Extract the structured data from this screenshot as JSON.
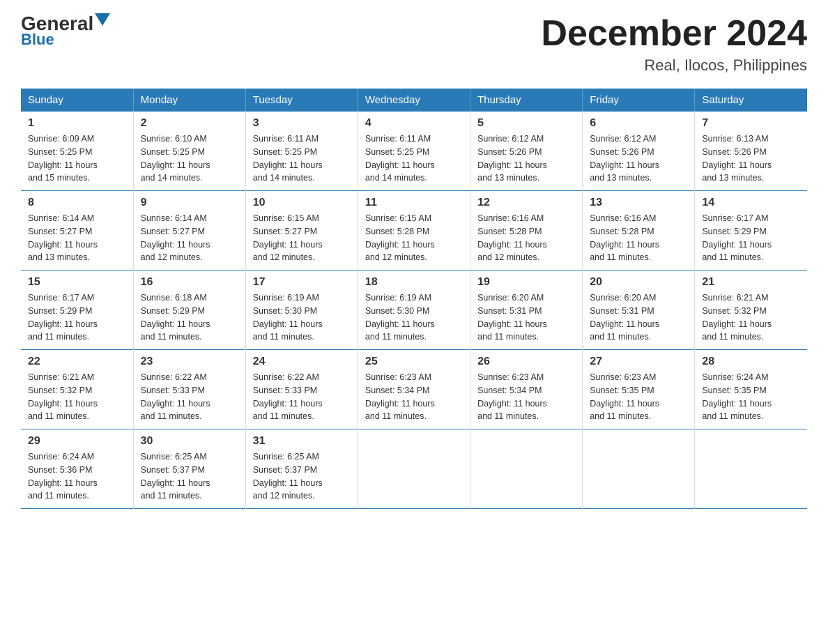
{
  "header": {
    "logo_general": "General",
    "logo_blue": "Blue",
    "title": "December 2024",
    "subtitle": "Real, Ilocos, Philippines"
  },
  "days_of_week": [
    "Sunday",
    "Monday",
    "Tuesday",
    "Wednesday",
    "Thursday",
    "Friday",
    "Saturday"
  ],
  "weeks": [
    [
      {
        "day": "1",
        "info": "Sunrise: 6:09 AM\nSunset: 5:25 PM\nDaylight: 11 hours\nand 15 minutes."
      },
      {
        "day": "2",
        "info": "Sunrise: 6:10 AM\nSunset: 5:25 PM\nDaylight: 11 hours\nand 14 minutes."
      },
      {
        "day": "3",
        "info": "Sunrise: 6:11 AM\nSunset: 5:25 PM\nDaylight: 11 hours\nand 14 minutes."
      },
      {
        "day": "4",
        "info": "Sunrise: 6:11 AM\nSunset: 5:25 PM\nDaylight: 11 hours\nand 14 minutes."
      },
      {
        "day": "5",
        "info": "Sunrise: 6:12 AM\nSunset: 5:26 PM\nDaylight: 11 hours\nand 13 minutes."
      },
      {
        "day": "6",
        "info": "Sunrise: 6:12 AM\nSunset: 5:26 PM\nDaylight: 11 hours\nand 13 minutes."
      },
      {
        "day": "7",
        "info": "Sunrise: 6:13 AM\nSunset: 5:26 PM\nDaylight: 11 hours\nand 13 minutes."
      }
    ],
    [
      {
        "day": "8",
        "info": "Sunrise: 6:14 AM\nSunset: 5:27 PM\nDaylight: 11 hours\nand 13 minutes."
      },
      {
        "day": "9",
        "info": "Sunrise: 6:14 AM\nSunset: 5:27 PM\nDaylight: 11 hours\nand 12 minutes."
      },
      {
        "day": "10",
        "info": "Sunrise: 6:15 AM\nSunset: 5:27 PM\nDaylight: 11 hours\nand 12 minutes."
      },
      {
        "day": "11",
        "info": "Sunrise: 6:15 AM\nSunset: 5:28 PM\nDaylight: 11 hours\nand 12 minutes."
      },
      {
        "day": "12",
        "info": "Sunrise: 6:16 AM\nSunset: 5:28 PM\nDaylight: 11 hours\nand 12 minutes."
      },
      {
        "day": "13",
        "info": "Sunrise: 6:16 AM\nSunset: 5:28 PM\nDaylight: 11 hours\nand 11 minutes."
      },
      {
        "day": "14",
        "info": "Sunrise: 6:17 AM\nSunset: 5:29 PM\nDaylight: 11 hours\nand 11 minutes."
      }
    ],
    [
      {
        "day": "15",
        "info": "Sunrise: 6:17 AM\nSunset: 5:29 PM\nDaylight: 11 hours\nand 11 minutes."
      },
      {
        "day": "16",
        "info": "Sunrise: 6:18 AM\nSunset: 5:29 PM\nDaylight: 11 hours\nand 11 minutes."
      },
      {
        "day": "17",
        "info": "Sunrise: 6:19 AM\nSunset: 5:30 PM\nDaylight: 11 hours\nand 11 minutes."
      },
      {
        "day": "18",
        "info": "Sunrise: 6:19 AM\nSunset: 5:30 PM\nDaylight: 11 hours\nand 11 minutes."
      },
      {
        "day": "19",
        "info": "Sunrise: 6:20 AM\nSunset: 5:31 PM\nDaylight: 11 hours\nand 11 minutes."
      },
      {
        "day": "20",
        "info": "Sunrise: 6:20 AM\nSunset: 5:31 PM\nDaylight: 11 hours\nand 11 minutes."
      },
      {
        "day": "21",
        "info": "Sunrise: 6:21 AM\nSunset: 5:32 PM\nDaylight: 11 hours\nand 11 minutes."
      }
    ],
    [
      {
        "day": "22",
        "info": "Sunrise: 6:21 AM\nSunset: 5:32 PM\nDaylight: 11 hours\nand 11 minutes."
      },
      {
        "day": "23",
        "info": "Sunrise: 6:22 AM\nSunset: 5:33 PM\nDaylight: 11 hours\nand 11 minutes."
      },
      {
        "day": "24",
        "info": "Sunrise: 6:22 AM\nSunset: 5:33 PM\nDaylight: 11 hours\nand 11 minutes."
      },
      {
        "day": "25",
        "info": "Sunrise: 6:23 AM\nSunset: 5:34 PM\nDaylight: 11 hours\nand 11 minutes."
      },
      {
        "day": "26",
        "info": "Sunrise: 6:23 AM\nSunset: 5:34 PM\nDaylight: 11 hours\nand 11 minutes."
      },
      {
        "day": "27",
        "info": "Sunrise: 6:23 AM\nSunset: 5:35 PM\nDaylight: 11 hours\nand 11 minutes."
      },
      {
        "day": "28",
        "info": "Sunrise: 6:24 AM\nSunset: 5:35 PM\nDaylight: 11 hours\nand 11 minutes."
      }
    ],
    [
      {
        "day": "29",
        "info": "Sunrise: 6:24 AM\nSunset: 5:36 PM\nDaylight: 11 hours\nand 11 minutes."
      },
      {
        "day": "30",
        "info": "Sunrise: 6:25 AM\nSunset: 5:37 PM\nDaylight: 11 hours\nand 11 minutes."
      },
      {
        "day": "31",
        "info": "Sunrise: 6:25 AM\nSunset: 5:37 PM\nDaylight: 11 hours\nand 12 minutes."
      },
      null,
      null,
      null,
      null
    ]
  ]
}
